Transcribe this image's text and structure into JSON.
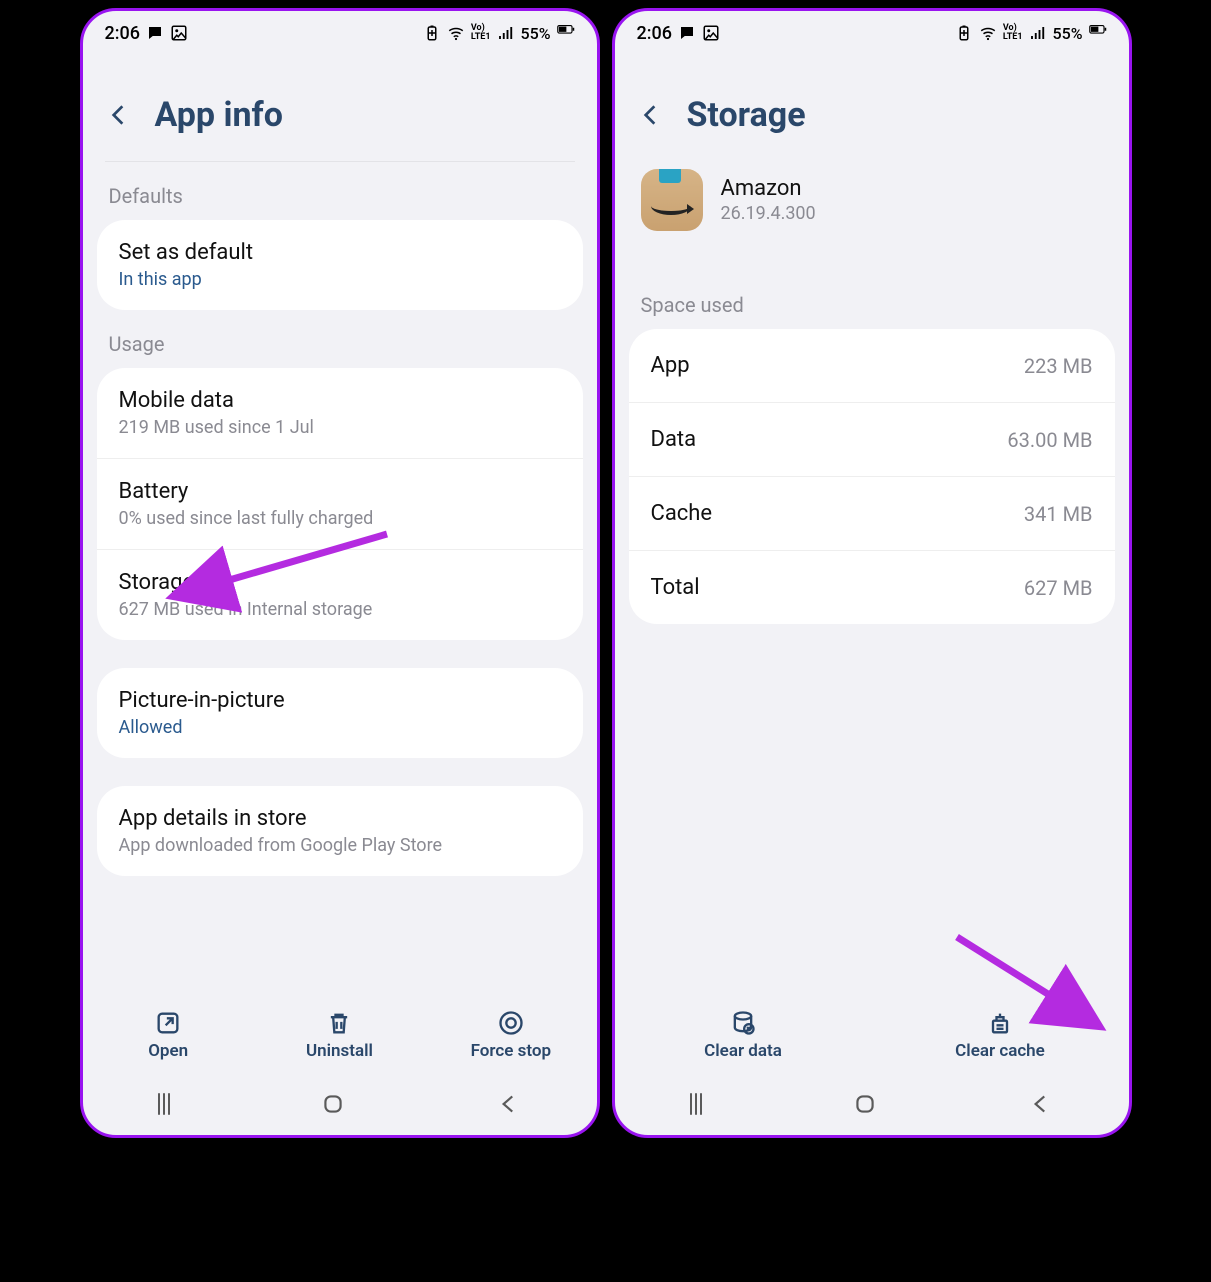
{
  "status": {
    "time": "2:06",
    "vo_label_top": "Vo)",
    "vo_label_bottom": "LTE1",
    "battery_pct": "55%"
  },
  "left": {
    "title": "App info",
    "sections": {
      "defaults_label": "Defaults",
      "usage_label": "Usage"
    },
    "defaults": {
      "set_default": {
        "title": "Set as default",
        "sub": "In this app"
      }
    },
    "usage": {
      "mobile_data": {
        "title": "Mobile data",
        "sub": "219 MB used since 1 Jul"
      },
      "battery": {
        "title": "Battery",
        "sub": "0% used since last fully charged"
      },
      "storage": {
        "title": "Storage",
        "sub": "627 MB used in Internal storage"
      }
    },
    "pip": {
      "title": "Picture-in-picture",
      "sub": "Allowed"
    },
    "store": {
      "title": "App details in store",
      "sub": "App downloaded from Google Play Store"
    },
    "actions": {
      "open": "Open",
      "uninstall": "Uninstall",
      "force_stop": "Force stop"
    }
  },
  "right": {
    "title": "Storage",
    "app": {
      "name": "Amazon",
      "version": "26.19.4.300"
    },
    "section_label": "Space used",
    "rows": {
      "app": {
        "key": "App",
        "val": "223 MB"
      },
      "data": {
        "key": "Data",
        "val": "63.00 MB"
      },
      "cache": {
        "key": "Cache",
        "val": "341 MB"
      },
      "total": {
        "key": "Total",
        "val": "627 MB"
      }
    },
    "actions": {
      "clear_data": "Clear data",
      "clear_cache": "Clear cache"
    }
  }
}
